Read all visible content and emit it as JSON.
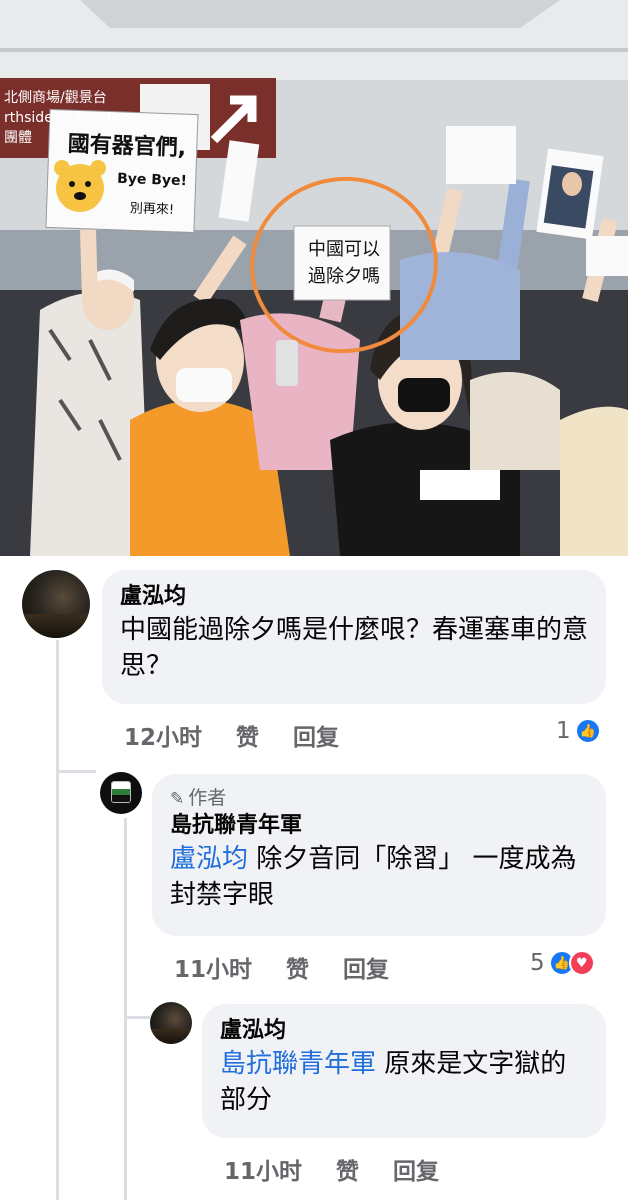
{
  "photo": {
    "overhead_sign": "北側商場/觀景台 rthside m   ervatory 團體",
    "pooh_sign": {
      "title": "國有器官們,",
      "bye": "Bye Bye!",
      "sub": "別再來!"
    },
    "center_sign": [
      "中國可以",
      "過除夕嗎"
    ]
  },
  "comments": [
    {
      "author": "盧泓均",
      "text": "中國能過除夕嗎是什麼哏？春運塞車的意思？",
      "time": "12小时",
      "like_label": "赞",
      "reply_label": "回复",
      "reaction_count": "1"
    },
    {
      "badge": "作者",
      "author": "島抗聯青年軍",
      "mention": "盧泓均",
      "text": " 除夕音同「除習」 一度成為封禁字眼",
      "time": "11小时",
      "like_label": "赞",
      "reply_label": "回复",
      "reaction_count": "5"
    },
    {
      "author": "盧泓均",
      "mention": "島抗聯青年軍",
      "text": " 原來是文字獄的部分",
      "time": "11小时",
      "like_label": "赞",
      "reply_label": "回复"
    }
  ],
  "colors": {
    "mention": "#216fdb",
    "bubble": "#f0f2f5",
    "like": "#1877f2",
    "love": "#f33e58",
    "circle_annotation": "#f08a3c"
  },
  "icons": [
    "pencil-icon",
    "like-icon",
    "love-icon"
  ]
}
